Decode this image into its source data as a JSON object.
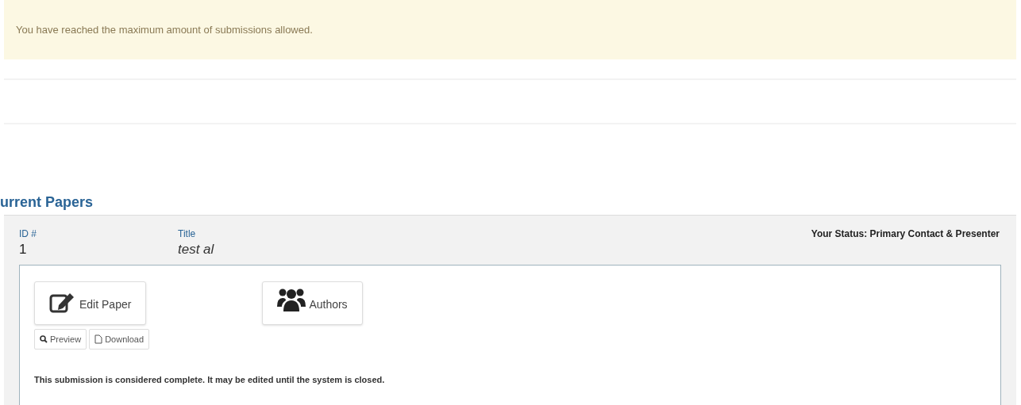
{
  "alert": {
    "text": "You have reached the maximum amount of submissions allowed."
  },
  "heading": "urrent Papers",
  "paper": {
    "id_label": "ID #",
    "id": "1",
    "title_label": "Title",
    "title": "test al",
    "status": "Your Status: Primary Contact & Presenter",
    "main_buttons": [
      {
        "kind": "edit",
        "label": "Edit Paper"
      },
      {
        "kind": "authors",
        "label": "Authors"
      }
    ],
    "small_buttons": [
      {
        "kind": "preview",
        "label": "Preview"
      },
      {
        "kind": "download",
        "label": "Download"
      }
    ],
    "note": "This submission is considered complete. It may be edited until the system is closed."
  }
}
